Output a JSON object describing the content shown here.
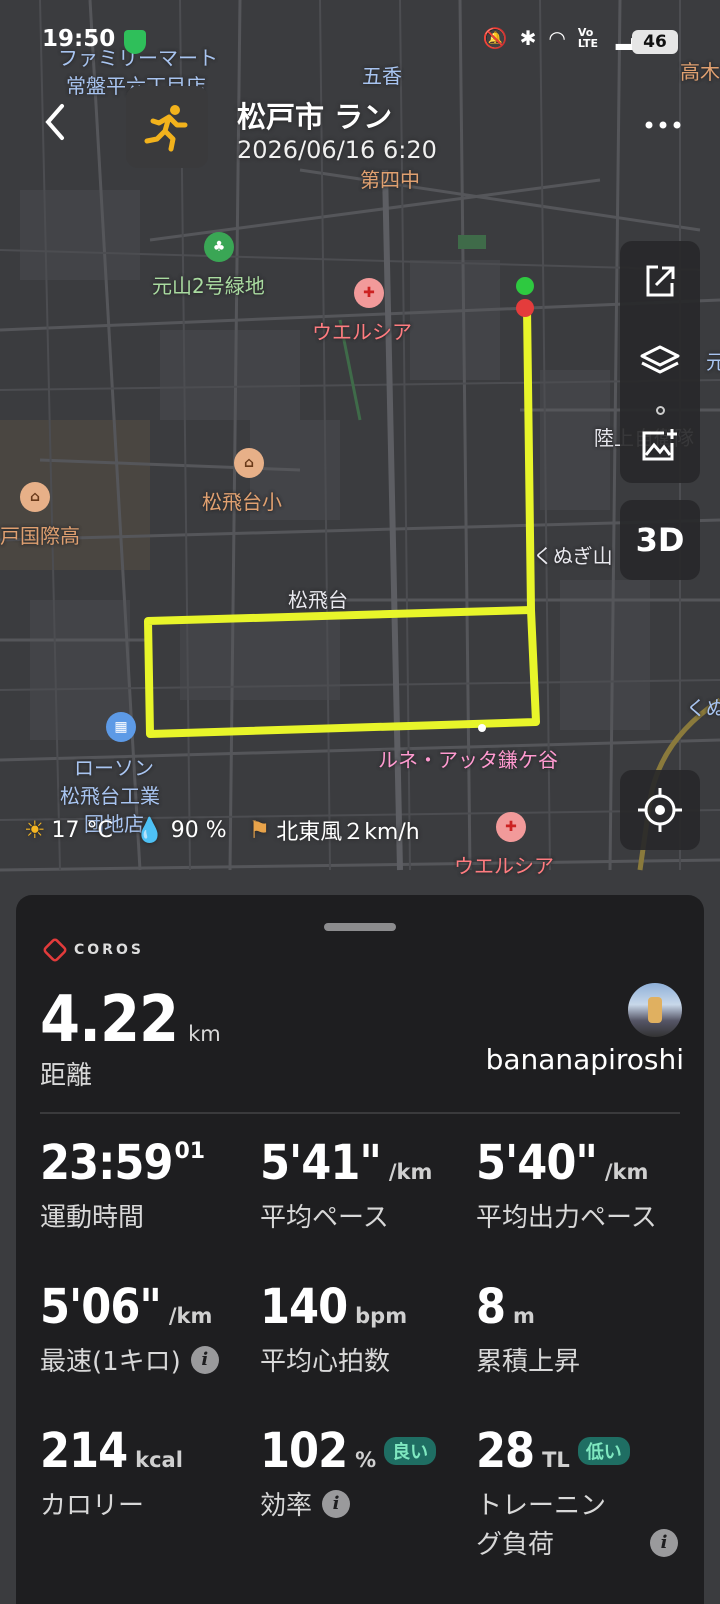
{
  "status_bar": {
    "time": "19:50",
    "network": "Vo LTE",
    "battery": "46"
  },
  "header": {
    "back_icon": "chevron-left-icon",
    "sport_icon": "running-icon",
    "title": "松戸市 ラン",
    "date": "2026/06/16 6:20",
    "more_icon": "more-horizontal-icon"
  },
  "map": {
    "labels": {
      "familymart": "ファミリーマート",
      "tokiwadaira": "常盤平六丁目店",
      "goka": "五香",
      "dai4chu": "第四中",
      "motoyama": "元山2号緑地",
      "welcia1": "ウエルシア",
      "matsuhidai_sho": "松飛台小",
      "kokusai": "戸国際高",
      "rikujo": "陸上自衛隊",
      "kunugiyama": "くぬぎ山",
      "matsuhidai": "松飛台",
      "lune": "ルネ・アッタ鎌ケ谷",
      "lawson1": "ローソン",
      "lawson2": "松飛台工業",
      "lawson3": "団地店",
      "welcia2": "ウエルシア",
      "takagi": "高木",
      "moto": "元",
      "kunu": "くぬ"
    },
    "route_color": "#e8f52a"
  },
  "toolbar": {
    "share_icon": "share-icon",
    "layers_icon": "layers-icon",
    "add_photo_icon": "add-photo-icon",
    "three_d_label": "3D",
    "locate_icon": "locate-icon"
  },
  "weather": {
    "temp": "17 °C",
    "humidity": "90 %",
    "wind": "北東風２km/h"
  },
  "summary": {
    "brand": "COROS",
    "distance_value": "4.22",
    "distance_unit": "km",
    "distance_label": "距離",
    "username": "bananapiroshi"
  },
  "metrics": {
    "time": {
      "value": "23:59",
      "sup": "01",
      "label": "運動時間"
    },
    "avg_pace": {
      "value": "5'41\"",
      "unit": "/km",
      "label": "平均ペース"
    },
    "avg_power_pace": {
      "value": "5'40\"",
      "unit": "/km",
      "label": "平均出力ペース"
    },
    "fastest": {
      "value": "5'06\"",
      "unit": "/km",
      "label": "最速(1キロ)"
    },
    "avg_hr": {
      "value": "140",
      "unit": "bpm",
      "label": "平均心拍数"
    },
    "elevation": {
      "value": "8",
      "unit": "m",
      "label": "累積上昇"
    },
    "calories": {
      "value": "214",
      "unit": "kcal",
      "label": "カロリー"
    },
    "efficiency": {
      "value": "102",
      "unit": "%",
      "badge": "良い",
      "label": "効率"
    },
    "training_load": {
      "value": "28",
      "unit": "TL",
      "badge": "低い",
      "label1": "トレーニン",
      "label2": "グ負荷"
    }
  }
}
